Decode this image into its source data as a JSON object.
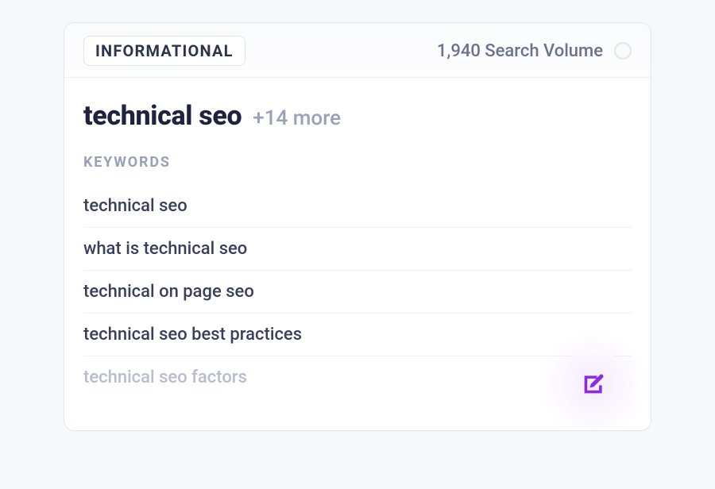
{
  "header": {
    "badge": "INFORMATIONAL",
    "volume_text": "1,940 Search Volume"
  },
  "title": {
    "main": "technical seo",
    "more": "+14 more"
  },
  "section_label": "KEYWORDS",
  "keywords": [
    "technical seo",
    "what is technical seo",
    "technical on page seo",
    "technical seo best practices",
    "technical seo factors"
  ],
  "colors": {
    "accent": "#8a2be2"
  }
}
